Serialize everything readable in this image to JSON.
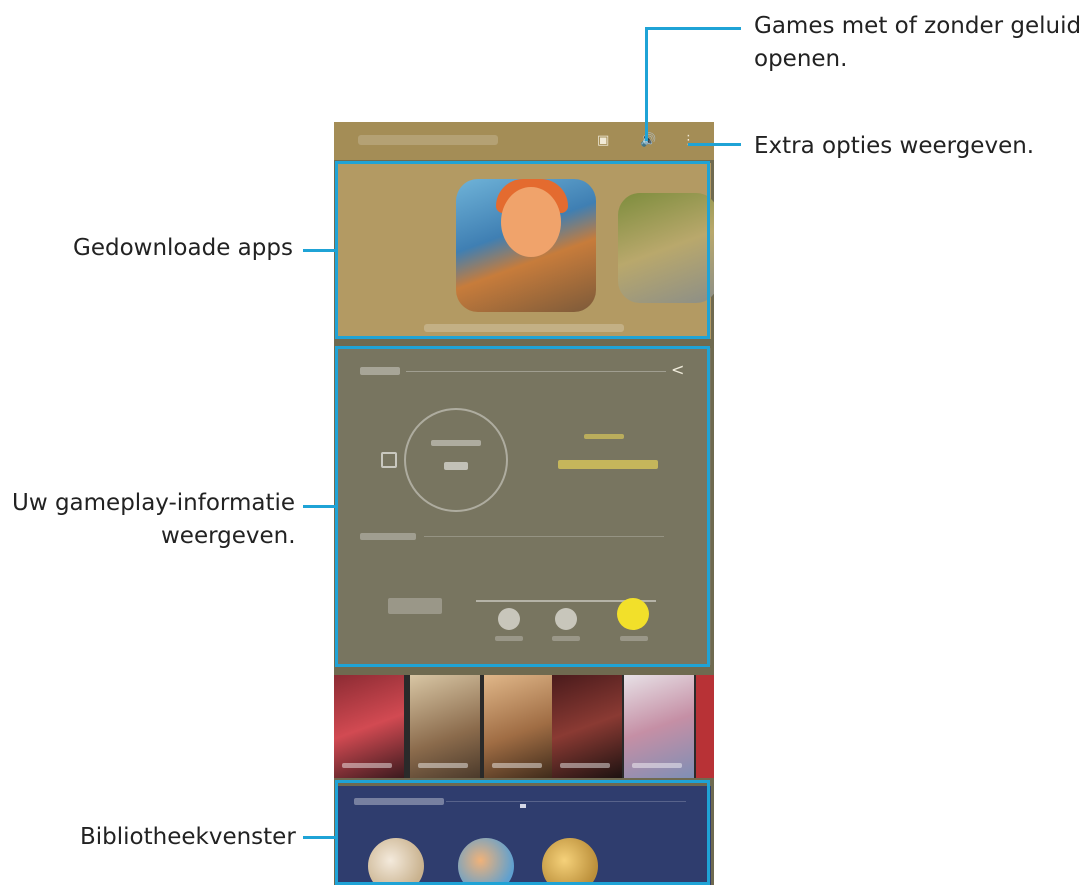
{
  "callouts": {
    "sound": [
      "Games met of zonder geluid",
      "openen."
    ],
    "more_options": "Extra opties weergeven.",
    "downloaded_apps": "Gedownloade apps",
    "gameplay_info": [
      "Uw gameplay-informatie",
      "weergeven."
    ],
    "library_panel": "Bibliotheekvenster"
  },
  "colors": {
    "callout_line": "#1fa3d6",
    "highlight_yellow": "#f2e02a"
  },
  "phone": {
    "topbar_icons": [
      "screen-icon",
      "volume-icon",
      "more-options-icon"
    ]
  }
}
